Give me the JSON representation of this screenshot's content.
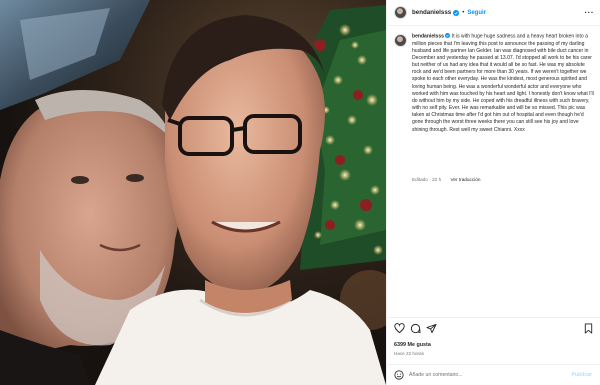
{
  "photo": {
    "icon": "selfie-photo",
    "colors": {
      "tree_green": "#1f5f2f",
      "fairy_light": "#ffcf6b",
      "ornament_red": "#8c1f1f",
      "shirt": "#f4f1ec"
    }
  },
  "header": {
    "username": "bendanielsss",
    "verified": true,
    "separator": "•",
    "follow_label": "Seguir",
    "more_icon": "ellipsis-icon"
  },
  "caption": {
    "username": "bendanielsss",
    "text": "It is with huge huge sadness and a heavy heart broken into a million pieces that I'm leaving this post to announce the passing of my darling husband and life partner Ian Gelder. Ian was diagnosed with bile duct cancer in December and yesterday he passed at 13.07. I'd stopped all work to be his carer but neither of us had any idea that it would all be so fast. He was my absolute rock and we'd been partners for more than 30 years. If we weren't together we spoke to each other everyday. He was the kindest, most generous spirited and loving human being. He was a wonderful wonderful actor and everyone who worked with him was touched by his heart and light. I honestly don't know what I'll do without him by my side. He coped with his dreadful illness with such bravery, with no self pity. Ever. He was remarkable and will be so missed. This pic was taken at Christmas time after I'd got him out of hospital and even though he'd gone through the worst three weeks there you can still see his joy and love shining through. Rest well my sweet Chianni. Xxxx",
    "edited": "Editado · 22 h",
    "translate": "Ver traducción"
  },
  "actions": {
    "icons": [
      "heart-icon",
      "comment-icon",
      "share-icon",
      "bookmark-icon"
    ]
  },
  "stats": {
    "likes": "6399 Me gusta",
    "posted": "Hace 22 horas"
  },
  "comment": {
    "emoji_icon": "emoji-icon",
    "placeholder": "Añade un comentario...",
    "publish_label": "Publicar"
  },
  "theme": {
    "accent": "#0095f6",
    "publish_disabled": "#b2dffc",
    "muted": "#737373"
  }
}
